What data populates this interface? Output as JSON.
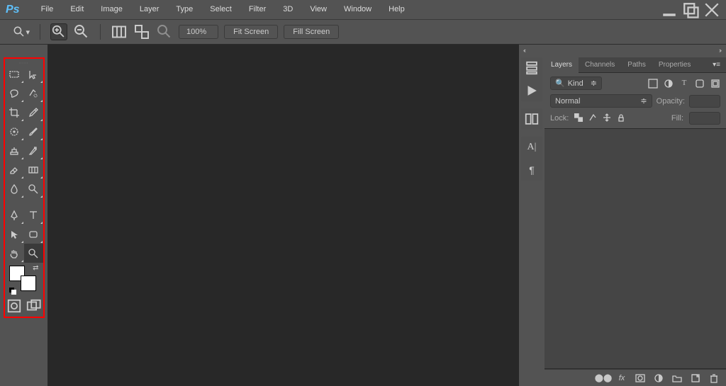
{
  "menubar": {
    "items": [
      "File",
      "Edit",
      "Image",
      "Layer",
      "Type",
      "Select",
      "Filter",
      "3D",
      "View",
      "Window",
      "Help"
    ]
  },
  "optionsbar": {
    "zoom_value": "100%",
    "fit_screen": "Fit Screen",
    "fill_screen": "Fill Screen"
  },
  "tools": [
    {
      "name": "marquee-tool",
      "flyout": true
    },
    {
      "name": "move-tool",
      "flyout": true
    },
    {
      "name": "lasso-tool",
      "flyout": true
    },
    {
      "name": "quick-selection-tool",
      "flyout": true
    },
    {
      "name": "crop-tool",
      "flyout": true
    },
    {
      "name": "eyedropper-tool",
      "flyout": true
    },
    {
      "name": "spot-healing-tool",
      "flyout": true
    },
    {
      "name": "brush-tool",
      "flyout": true
    },
    {
      "name": "clone-stamp-tool",
      "flyout": true
    },
    {
      "name": "history-brush-tool",
      "flyout": true
    },
    {
      "name": "eraser-tool",
      "flyout": true
    },
    {
      "name": "gradient-tool",
      "flyout": true
    },
    {
      "name": "blur-tool",
      "flyout": true
    },
    {
      "name": "dodge-tool",
      "flyout": true
    },
    {
      "name": "pen-tool",
      "flyout": true
    },
    {
      "name": "type-tool",
      "flyout": true
    },
    {
      "name": "path-selection-tool",
      "flyout": true
    },
    {
      "name": "rectangle-tool",
      "flyout": true
    },
    {
      "name": "hand-tool",
      "flyout": true
    },
    {
      "name": "zoom-tool",
      "flyout": false,
      "selected": true
    }
  ],
  "panel": {
    "tabs": [
      "Layers",
      "Channels",
      "Paths",
      "Properties"
    ],
    "active_tab": 0,
    "filter_label": "Kind",
    "blend_mode": "Normal",
    "opacity_label": "Opacity:",
    "lock_label": "Lock:",
    "fill_label": "Fill:"
  },
  "icons": {
    "search": "search-icon",
    "minimize": "minimize-icon",
    "maximize": "maximize-icon",
    "close": "close-icon"
  }
}
